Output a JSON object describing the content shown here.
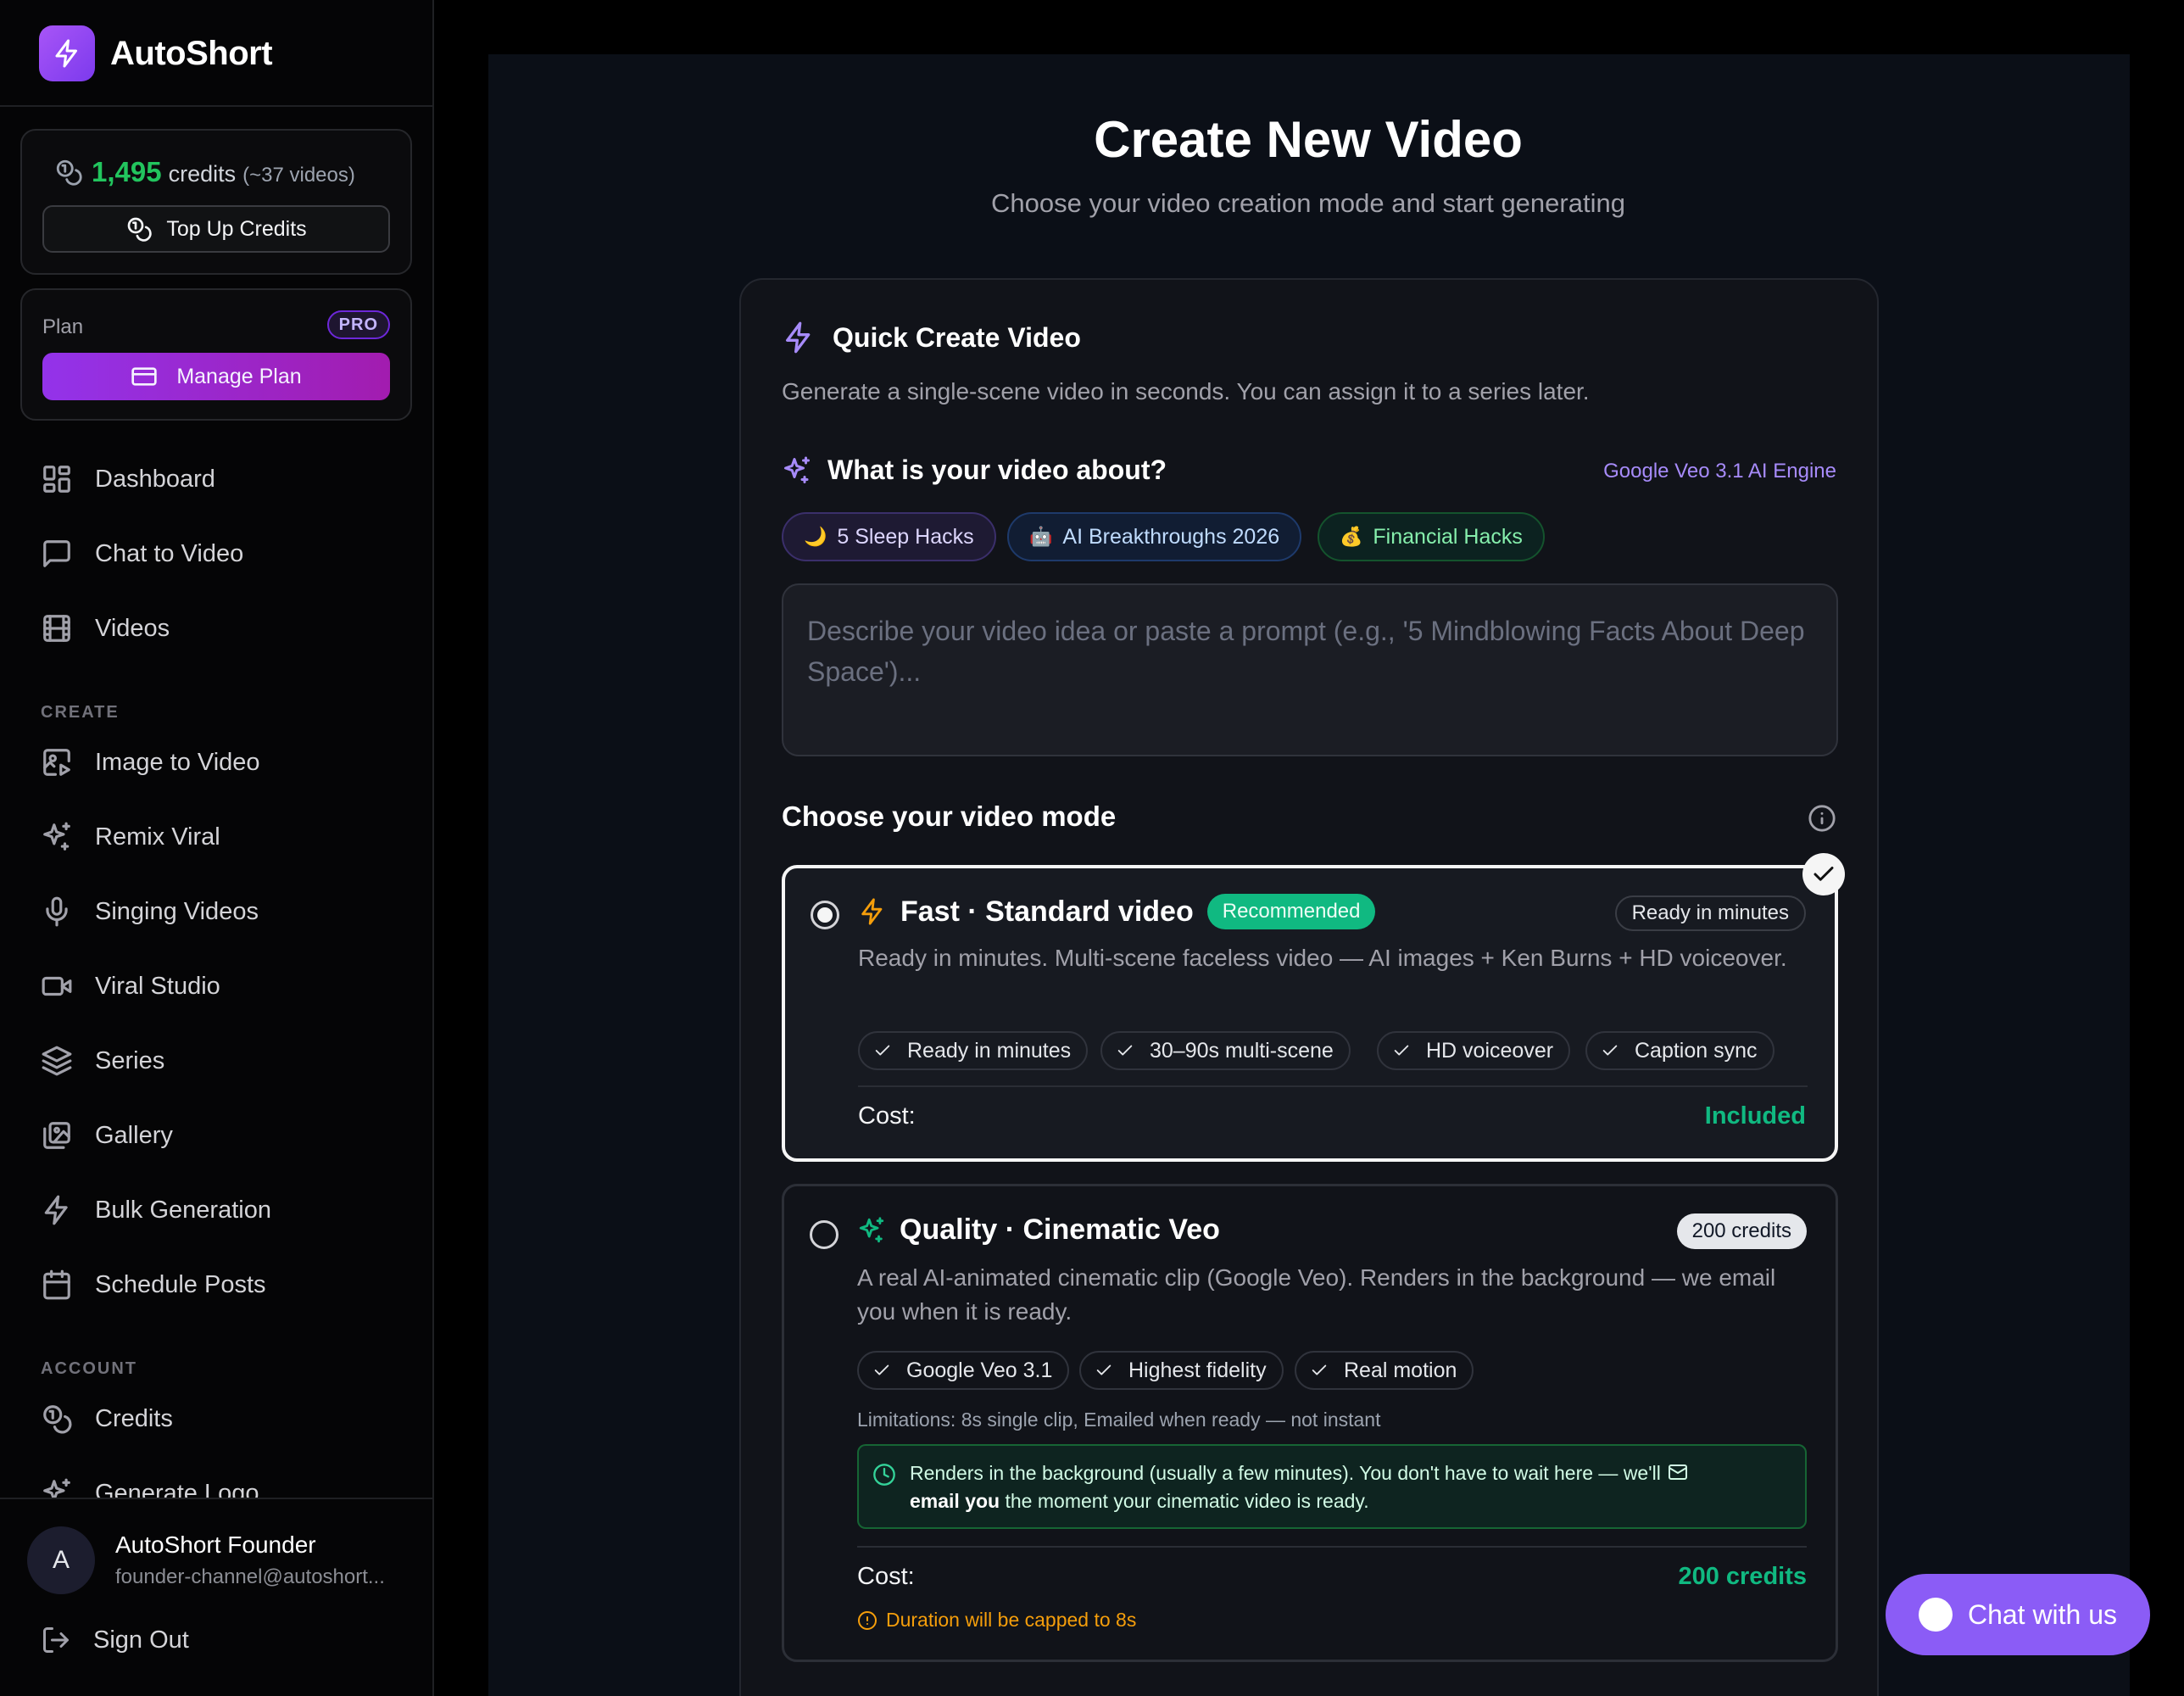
{
  "app": {
    "name": "AutoShort"
  },
  "credits": {
    "amount": "1,495",
    "unit": "credits",
    "estimate": "(~37 videos)",
    "topup_label": "Top Up Credits"
  },
  "plan": {
    "label": "Plan",
    "badge": "PRO",
    "manage_label": "Manage Plan"
  },
  "nav": {
    "main": [
      {
        "label": "Dashboard",
        "icon": "grid-icon"
      },
      {
        "label": "Chat to Video",
        "icon": "chat-icon"
      },
      {
        "label": "Videos",
        "icon": "film-icon"
      }
    ],
    "create_section": "CREATE",
    "create": [
      {
        "label": "Image to Video",
        "icon": "image-play-icon"
      },
      {
        "label": "Remix Viral",
        "icon": "sparkles-icon"
      },
      {
        "label": "Singing Videos",
        "icon": "microphone-icon"
      },
      {
        "label": "Viral Studio",
        "icon": "video-camera-icon"
      },
      {
        "label": "Series",
        "icon": "layers-icon"
      },
      {
        "label": "Gallery",
        "icon": "gallery-icon"
      },
      {
        "label": "Bulk Generation",
        "icon": "lightning-icon"
      },
      {
        "label": "Schedule Posts",
        "icon": "calendar-icon"
      }
    ],
    "account_section": "ACCOUNT",
    "account": [
      {
        "label": "Credits",
        "icon": "coins-icon"
      },
      {
        "label": "Generate Logo",
        "icon": "sparkles-icon"
      }
    ]
  },
  "user": {
    "initial": "A",
    "name": "AutoShort Founder",
    "email": "founder-channel@autoshort...",
    "signout_label": "Sign Out"
  },
  "page": {
    "title": "Create New Video",
    "subtitle": "Choose your video creation mode and start generating"
  },
  "quick_create": {
    "title": "Quick Create Video",
    "description": "Generate a single-scene video in seconds. You can assign it to a series later.",
    "question": "What is your video about?",
    "engine": "Google Veo 3.1 AI Engine",
    "suggestions": [
      {
        "emoji": "🌙",
        "label": "5 Sleep Hacks"
      },
      {
        "emoji": "🤖",
        "label": "AI Breakthroughs 2026"
      },
      {
        "emoji": "💰",
        "label": "Financial Hacks"
      }
    ],
    "prompt_placeholder": "Describe your video idea or paste a prompt (e.g., '5 Mindblowing Facts About Deep Space')...",
    "prompt_value": ""
  },
  "modes": {
    "label": "Choose your video mode",
    "fast": {
      "title": "Fast · Standard video",
      "badge": "Recommended",
      "tag": "Ready in minutes",
      "selected": true,
      "description": "Ready in minutes. Multi-scene faceless video — AI images + Ken Burns + HD voiceover.",
      "features": [
        "Ready in minutes",
        "30–90s multi-scene",
        "HD voiceover",
        "Caption sync"
      ],
      "cost_label": "Cost:",
      "cost_value": "Included"
    },
    "quality": {
      "title": "Quality · Cinematic Veo",
      "tag": "200 credits",
      "selected": false,
      "description": "A real AI-animated cinematic clip (Google Veo). Renders in the background — we email you when it is ready.",
      "features": [
        "Google Veo 3.1",
        "Highest fidelity",
        "Real motion"
      ],
      "limitations": "Limitations: 8s single clip, Emailed when ready — not instant",
      "notice_pre": "Renders in the background (usually a few minutes). You don't have to wait here — we'll",
      "notice_bold": "email you",
      "notice_post": "the moment your cinematic video is ready.",
      "cost_label": "Cost:",
      "cost_value": "200 credits",
      "warning": "Duration will be capped to 8s"
    }
  },
  "chat": {
    "label": "Chat with us"
  },
  "colors": {
    "accent": "#8b5cf6",
    "success": "#10b981",
    "credits": "#22c55e",
    "warning": "#f59e0b"
  }
}
